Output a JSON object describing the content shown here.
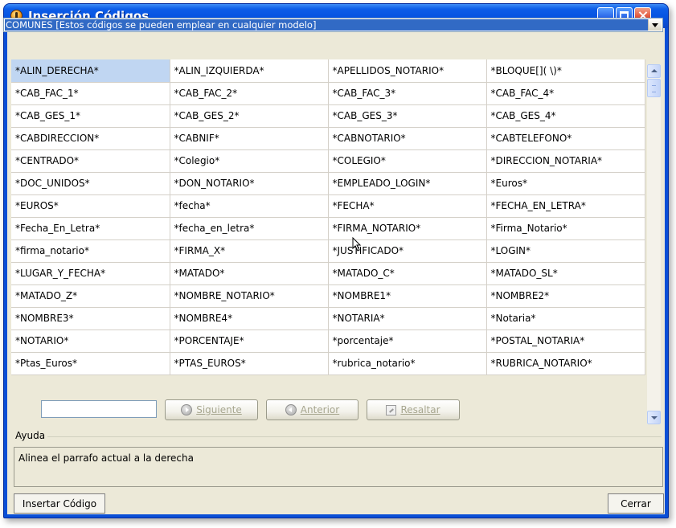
{
  "window": {
    "title": "Inserción Códigos"
  },
  "category_select": {
    "selected": "COMUNES [Estos códigos se pueden emplear en cualquier modelo]"
  },
  "codes": {
    "selected_index": 0,
    "rows": [
      [
        "*ALIN_DERECHA*",
        "*ALIN_IZQUIERDA*",
        "*APELLIDOS_NOTARIO*",
        "*BLOQUE[]( \\)*"
      ],
      [
        "*CAB_FAC_1*",
        "*CAB_FAC_2*",
        "*CAB_FAC_3*",
        "*CAB_FAC_4*"
      ],
      [
        "*CAB_GES_1*",
        "*CAB_GES_2*",
        "*CAB_GES_3*",
        "*CAB_GES_4*"
      ],
      [
        "*CABDIRECCION*",
        "*CABNIF*",
        "*CABNOTARIO*",
        "*CABTELEFONO*"
      ],
      [
        "*CENTRADO*",
        "*Colegio*",
        "*COLEGIO*",
        "*DIRECCION_NOTARIA*"
      ],
      [
        "*DOC_UNIDOS*",
        "*DON_NOTARIO*",
        "*EMPLEADO_LOGIN*",
        "*Euros*"
      ],
      [
        "*EUROS*",
        "*fecha*",
        "*FECHA*",
        "*FECHA_EN_LETRA*"
      ],
      [
        "*Fecha_En_Letra*",
        "*fecha_en_letra*",
        "*FIRMA_NOTARIO*",
        "*Firma_Notario*"
      ],
      [
        "*firma_notario*",
        "*FIRMA_X*",
        "*JUSTIFICADO*",
        "*LOGIN*"
      ],
      [
        "*LUGAR_Y_FECHA*",
        "*MATADO*",
        "*MATADO_C*",
        "*MATADO_SL*"
      ],
      [
        "*MATADO_Z*",
        "*NOMBRE_NOTARIO*",
        "*NOMBRE1*",
        "*NOMBRE2*"
      ],
      [
        "*NOMBRE3*",
        "*NOMBRE4*",
        "*NOTARIA*",
        "*Notaria*"
      ],
      [
        "*NOTARIO*",
        "*PORCENTAJE*",
        "*porcentaje*",
        "*POSTAL_NOTARIA*"
      ],
      [
        "*Ptas_Euros*",
        "*PTAS_EUROS*",
        "*rubrica_notario*",
        "*RUBRICA_NOTARIO*"
      ]
    ]
  },
  "search": {
    "value": "",
    "next_label": "Siguiente",
    "prev_label": "Anterior",
    "highlight_label": "Resaltar"
  },
  "help": {
    "title": "Ayuda",
    "text": "Alinea el parrafo actual a la derecha"
  },
  "footer": {
    "insert_label": "Insertar Código",
    "close_label": "Cerrar"
  },
  "colors": {
    "titlebar": "#0553e1",
    "selection": "#316ac5",
    "selected_cell": "#c0d6f2",
    "panel": "#ece9d8"
  },
  "icons": {
    "app": "app-orb-icon",
    "next": "circle-arrow-right-icon",
    "prev": "circle-arrow-left-icon",
    "highlight": "highlighter-icon"
  }
}
